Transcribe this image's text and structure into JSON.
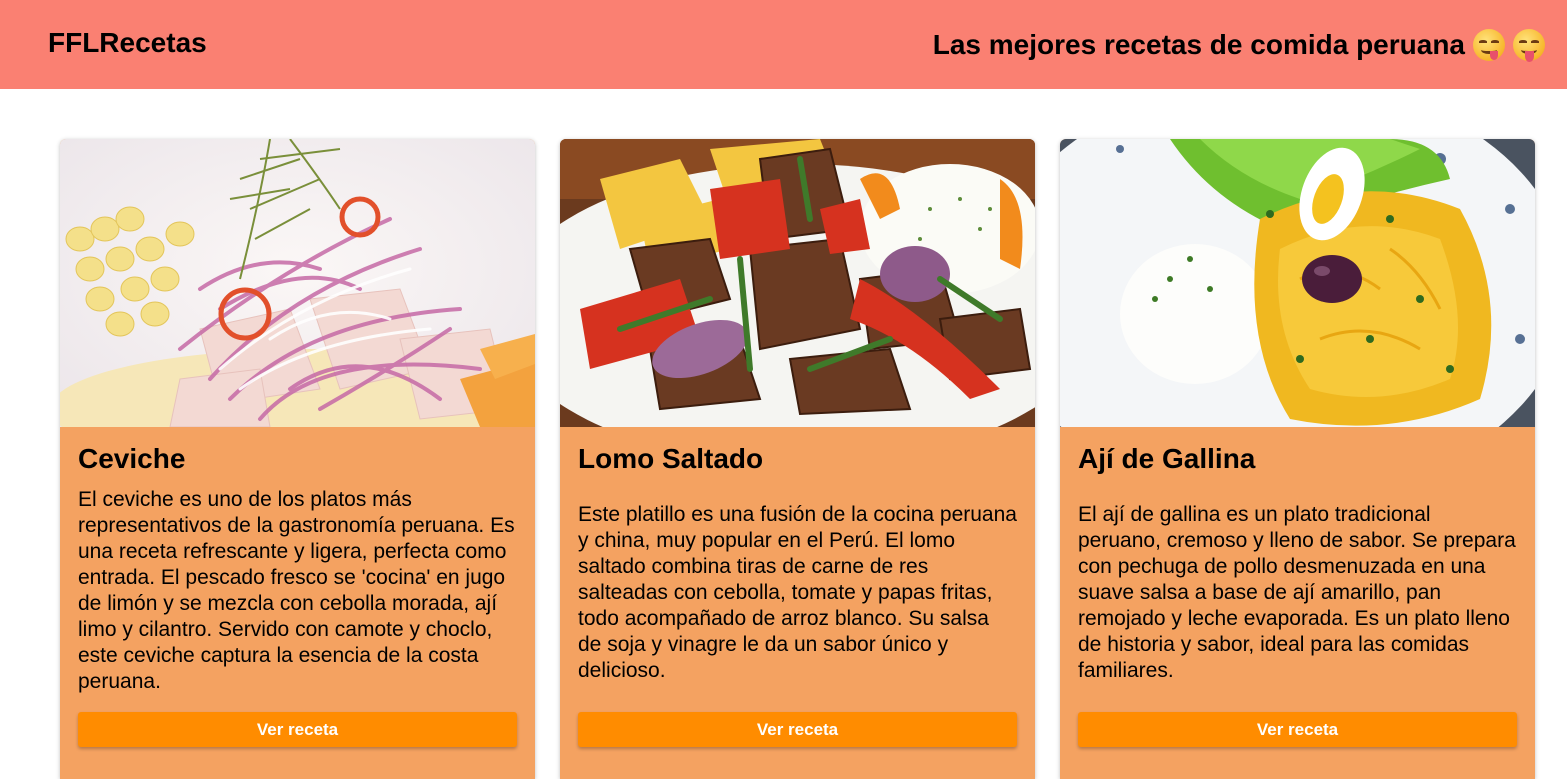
{
  "header": {
    "brand": "FFLRecetas",
    "tagline": "Las mejores recetas de comida peruana",
    "emojis": [
      "face-savoring-food-icon",
      "face-with-tongue-icon"
    ]
  },
  "colors": {
    "header_bg": "#fa8072",
    "card_bg": "#f4a261",
    "button_bg": "#ff8c00",
    "button_text": "#ffffff"
  },
  "cards": [
    {
      "image": "ceviche-photo",
      "title": "Ceviche",
      "text": "El ceviche es uno de los platos más representativos de la gastronomía peruana. Es una receta refrescante y ligera, perfecta como entrada. El pescado fresco se 'cocina' en jugo de limón y se mezcla con cebolla morada, ají limo y cilantro. Servido con camote y choclo, este ceviche captura la esencia de la costa peruana.",
      "button": "Ver receta"
    },
    {
      "image": "lomo-saltado-photo",
      "title": "Lomo Saltado",
      "text": "Este platillo es una fusión de la cocina peruana y china, muy popular en el Perú. El lomo saltado combina tiras de carne de res salteadas con cebolla, tomate y papas fritas, todo acompañado de arroz blanco. Su salsa de soja y vinagre le da un sabor único y delicioso.",
      "button": "Ver receta"
    },
    {
      "image": "aji-de-gallina-photo",
      "title": "Ají de Gallina",
      "text": "El ají de gallina es un plato tradicional peruano, cremoso y lleno de sabor. Se prepara con pechuga de pollo desmenuzada en una suave salsa a base de ají amarillo, pan remojado y leche evaporada. Es un plato lleno de historia y sabor, ideal para las comidas familiares.",
      "button": "Ver receta"
    }
  ]
}
